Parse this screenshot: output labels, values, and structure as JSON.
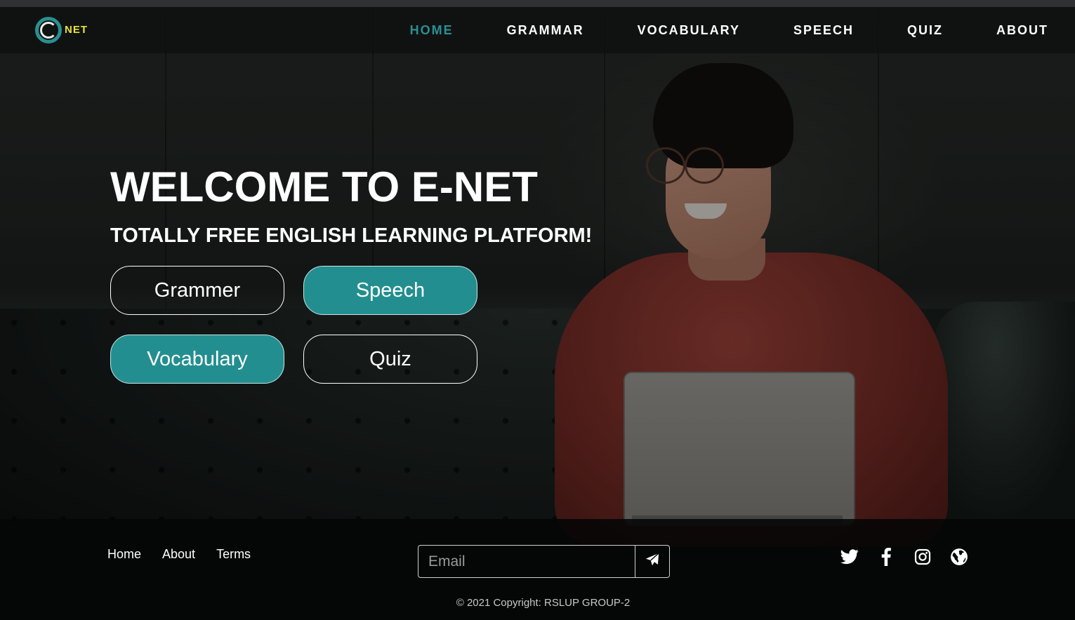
{
  "brand": {
    "logo_text": "NET"
  },
  "nav": {
    "items": [
      {
        "label": "HOME",
        "active": true
      },
      {
        "label": "GRAMMAR",
        "active": false
      },
      {
        "label": "VOCABULARY",
        "active": false
      },
      {
        "label": "SPEECH",
        "active": false
      },
      {
        "label": "QUIZ",
        "active": false
      },
      {
        "label": "ABOUT",
        "active": false
      }
    ]
  },
  "hero": {
    "title": "WELCOME TO E-NET",
    "subtitle": "TOTALLY FREE ENGLISH LEARNING PLATFORM!",
    "buttons": [
      {
        "label": "Grammer",
        "style": "outline"
      },
      {
        "label": "Speech",
        "style": "filled"
      },
      {
        "label": "Vocabulary",
        "style": "filled"
      },
      {
        "label": "Quiz",
        "style": "outline"
      }
    ]
  },
  "footer": {
    "links": [
      "Home",
      "About",
      "Terms"
    ],
    "email": {
      "placeholder": "Email",
      "value": ""
    },
    "send_icon": "paper-plane-icon",
    "socials": [
      "twitter-icon",
      "facebook-icon",
      "instagram-icon",
      "globe-icon"
    ],
    "copyright": "© 2021 Copyright: RSLUP GROUP-2"
  },
  "colors": {
    "accent": "#238e8f",
    "logo_yellow": "#e9e33c",
    "nav_bg": "#0f1010",
    "text": "#ffffff"
  }
}
